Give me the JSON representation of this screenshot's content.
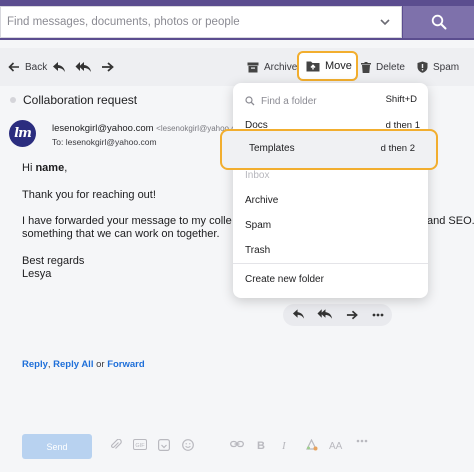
{
  "search": {
    "placeholder": "Find messages, documents, photos or people"
  },
  "toolbar": {
    "back_label": "Back",
    "archive_label": "Archive",
    "move_label": "Move",
    "delete_label": "Delete",
    "spam_label": "Spam"
  },
  "message": {
    "subject": "Collaboration request",
    "avatar_text": "lm",
    "from_name": "lesenokgirl@yahoo.com",
    "from_address": "<lesenokgirl@yahoo.com>",
    "to_prefix": "To:",
    "to_address": "lesenokgirl@yahoo.com",
    "greeting_prefix": "Hi ",
    "greeting_name": "name",
    "greeting_suffix": ",",
    "line_thanks": "Thank you for reaching out!",
    "line_forward_start": "I have forwarded your message to my colle",
    "line_forward_end": "and SEO.",
    "line_together": "something that we can work on together.",
    "signoff": "Best regards",
    "signature": "Lesya"
  },
  "reply": {
    "reply_label": "Reply",
    "reply_all_label": "Reply All",
    "or_label": "or",
    "forward_label": "Forward",
    "separator": ","
  },
  "compose": {
    "send_label": "Send"
  },
  "move_menu": {
    "search_placeholder": "Find a folder",
    "search_shortcut": "Shift+D",
    "items": [
      {
        "label": "Docs",
        "shortcut": "d then 1"
      },
      {
        "label": "Templates",
        "shortcut": "d then 2"
      },
      {
        "label": "Inbox",
        "shortcut": ""
      },
      {
        "label": "Archive",
        "shortcut": ""
      },
      {
        "label": "Spam",
        "shortcut": ""
      },
      {
        "label": "Trash",
        "shortcut": ""
      }
    ],
    "create_label": "Create new folder"
  },
  "colors": {
    "header_bg": "#5b4d8f",
    "highlight": "#f2ae2e",
    "link": "#1e6fd9",
    "send_disabled": "#b8d2f0"
  }
}
